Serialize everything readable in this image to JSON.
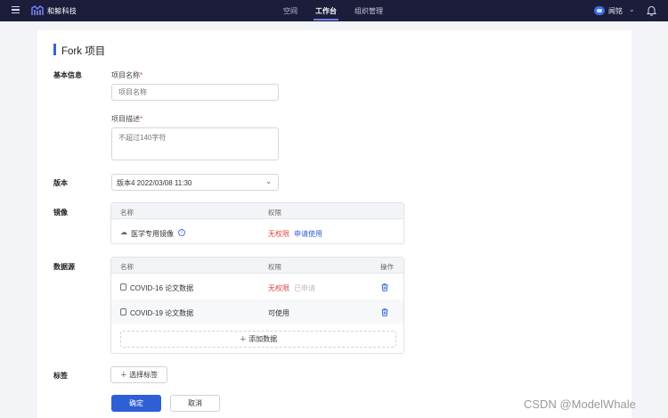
{
  "navbar": {
    "brand": "和鲸科技",
    "tabs": [
      {
        "label": "空间"
      },
      {
        "label": "工作台",
        "active": true
      },
      {
        "label": "组织管理"
      }
    ],
    "user_name": "闻铭"
  },
  "page": {
    "title": "Fork 项目"
  },
  "sections": {
    "basic_info": "基本信息",
    "version": "版本",
    "image": "镜像",
    "datasource": "数据源",
    "tags": "标签"
  },
  "form": {
    "project_name": {
      "label": "项目名称",
      "required_mark": "*",
      "placeholder": "项目名称",
      "value": ""
    },
    "project_desc": {
      "label": "项目描述",
      "required_mark": "*",
      "placeholder": "不超过140字符",
      "value": ""
    },
    "version_select": {
      "value": "版本4 2022/03/08 11:30"
    }
  },
  "image_table": {
    "columns": [
      "名称",
      "权限"
    ],
    "rows": [
      {
        "name": "医学专用镜像",
        "permission": "无权限",
        "action": "申请使用"
      }
    ]
  },
  "datasource_table": {
    "columns": [
      "名称",
      "权限",
      "操作"
    ],
    "rows": [
      {
        "name": "COVID-16 论文数据",
        "permission": "无权限",
        "status": "已申请"
      },
      {
        "name": "COVID-19 论文数据",
        "permission": "可使用",
        "status": ""
      }
    ],
    "add_button": "添加数据"
  },
  "tags": {
    "select_button": "选择标签"
  },
  "actions": {
    "confirm": "确定",
    "cancel": "取消"
  },
  "watermark": "CSDN @ModelWhale",
  "colors": {
    "primary": "#2f5fd6",
    "danger": "#d94646",
    "nav_bg": "#1c1d3a"
  }
}
